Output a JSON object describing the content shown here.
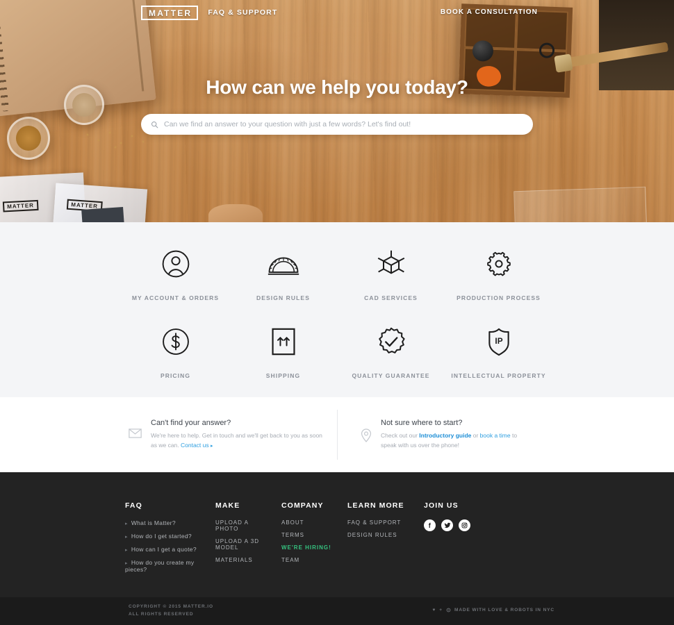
{
  "colors": {
    "accent_link": "#2f9fe0",
    "hiring_green": "#35c27f",
    "footer_bg": "#232323",
    "cats_bg": "#f4f5f7",
    "label_gray": "#8b9099"
  },
  "header": {
    "logo": "MATTER",
    "section_label": "FAQ & SUPPORT",
    "cta": "BOOK A CONSULTATION"
  },
  "hero": {
    "title": "How can we help you today?",
    "search": {
      "value": "",
      "placeholder": "Can we find an answer to your question with just a few words? Let's find out!",
      "icon": "search-icon"
    }
  },
  "categories": [
    {
      "label": "MY ACCOUNT & ORDERS",
      "icon": "user-circle-icon"
    },
    {
      "label": "DESIGN RULES",
      "icon": "protractor-icon"
    },
    {
      "label": "CAD SERVICES",
      "icon": "cube-3d-icon"
    },
    {
      "label": "PRODUCTION PROCESS",
      "icon": "gear-icon"
    },
    {
      "label": "PRICING",
      "icon": "dollar-circle-icon"
    },
    {
      "label": "SHIPPING",
      "icon": "this-side-up-box-icon"
    },
    {
      "label": "QUALITY GUARANTEE",
      "icon": "check-badge-icon"
    },
    {
      "label": "INTELLECTUAL PROPERTY",
      "icon": "shield-ip-icon"
    }
  ],
  "help": {
    "left": {
      "icon": "envelope-icon",
      "heading": "Can't find your answer?",
      "body_before": "We're here to help. Get in touch and we'll get back to you as soon as we can. ",
      "link": "Contact us",
      "link_caret": "▸"
    },
    "right": {
      "icon": "map-pin-icon",
      "heading": "Not sure where to start?",
      "body_before": "Check out our ",
      "link_bold": "Introductory guide",
      "body_middle": " or ",
      "link_plain": "book a time",
      "body_after": " to speak with us over the phone!"
    }
  },
  "footer": {
    "columns": [
      {
        "heading": "FAQ",
        "bulleted": true,
        "links": [
          "What is Matter?",
          "How do I get started?",
          "How can I get a quote?",
          "How do you create my pieces?"
        ]
      },
      {
        "heading": "MAKE",
        "bulleted": false,
        "links": [
          "UPLOAD A PHOTO",
          "UPLOAD A 3D MODEL",
          "MATERIALS"
        ]
      },
      {
        "heading": "COMPANY",
        "bulleted": false,
        "links": [
          "ABOUT",
          "TERMS",
          "WE'RE HIRING!",
          "TEAM"
        ],
        "highlight_index": 2
      },
      {
        "heading": "LEARN MORE",
        "bulleted": false,
        "links": [
          "FAQ & SUPPORT",
          "DESIGN RULES"
        ]
      }
    ],
    "join": {
      "heading": "JOIN US",
      "socials": [
        {
          "name": "facebook-icon",
          "glyph": "f"
        },
        {
          "name": "twitter-icon",
          "glyph": "t"
        },
        {
          "name": "instagram-icon",
          "glyph": "i"
        }
      ]
    },
    "copyright_line1": "COPYRIGHT © 2015 MATTER.IO",
    "copyright_line2": "ALL RIGHTS RESERVED",
    "made_with": "MADE WITH LOVE & ROBOTS IN NYC",
    "made_heart": "♥",
    "made_plus": "+"
  }
}
